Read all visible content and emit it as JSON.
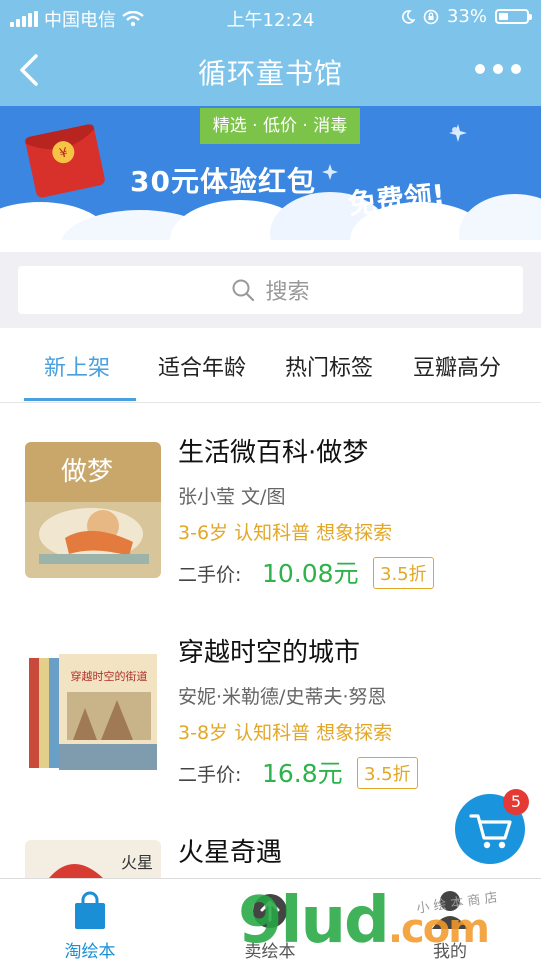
{
  "status_bar": {
    "carrier": "中国电信",
    "time": "上午12:24",
    "battery": "33%",
    "battery_level": 0.33
  },
  "nav": {
    "title": "循环童书馆"
  },
  "banner": {
    "tag": "精选 · 低价 · 消毒",
    "headline": "30元体验红包",
    "cta": "免费领!",
    "packet_symbol": "¥"
  },
  "search": {
    "placeholder": "搜索"
  },
  "tabs": [
    {
      "label": "新上架",
      "active": true
    },
    {
      "label": "适合年龄",
      "active": false
    },
    {
      "label": "热门标签",
      "active": false
    },
    {
      "label": "豆瓣高分",
      "active": false
    }
  ],
  "books": [
    {
      "title": "生活微百科·做梦",
      "author": "张小莹 文/图",
      "tags": "3-6岁 认知科普 想象探索",
      "price_label": "二手价:",
      "price": "10.08元",
      "discount": "3.5折",
      "cover_text": "做梦"
    },
    {
      "title": "穿越时空的城市",
      "author": "安妮·米勒德/史蒂夫·努恩",
      "tags": "3-8岁 认知科普 想象探索",
      "price_label": "二手价:",
      "price": "16.8元",
      "discount": "3.5折",
      "cover_text": "穿越时空的街道"
    },
    {
      "title": "火星奇遇",
      "author": "",
      "tags": "",
      "price_label": "",
      "price": "",
      "discount": "",
      "cover_text": "火星"
    }
  ],
  "cart": {
    "count": "5"
  },
  "tab_bar": [
    {
      "label": "淘绘本",
      "icon": "bag-icon",
      "active": true
    },
    {
      "label": "卖绘本",
      "icon": "upload-icon",
      "active": false
    },
    {
      "label": "我的",
      "icon": "person-icon",
      "active": false
    }
  ],
  "watermark": {
    "main": "9lud",
    "suffix": ".com",
    "small": "小 绘 本 商 店"
  },
  "colors": {
    "nav": "#7ec4ea",
    "banner": "#3a86e0",
    "accent": "#4aa0df",
    "price": "#2eb24b",
    "tag": "#e3a727",
    "cart": "#1a94dc",
    "badge": "#e53935"
  }
}
